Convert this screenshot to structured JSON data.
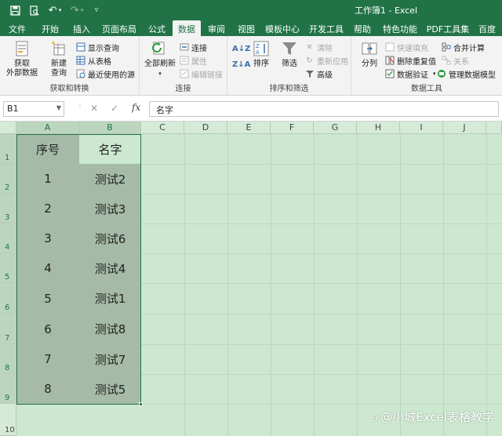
{
  "window": {
    "title": "工作簿1  -  Excel",
    "quick_access": [
      "save-icon",
      "print-preview-icon",
      "undo-icon",
      "redo-icon",
      "customize-icon"
    ]
  },
  "tabs": [
    "文件",
    "开始",
    "插入",
    "页面布局",
    "公式",
    "数据",
    "审阅",
    "视图",
    "模板中心",
    "开发工具",
    "帮助",
    "特色功能",
    "PDF工具集",
    "百度"
  ],
  "active_tab": "数据",
  "ribbon": {
    "group1": {
      "label": "获取和转换",
      "get_data": "获取\n外部数据",
      "new_query": "新建\n查询",
      "show_query": "显示查询",
      "from_table": "从表格",
      "recent_sources": "最近使用的源"
    },
    "group2": {
      "label": "连接",
      "refresh_all": "全部刷新",
      "connections": "连接",
      "properties": "属性",
      "edit_links": "编辑链接"
    },
    "group3": {
      "label": "排序和筛选",
      "sort": "排序",
      "filter": "筛选",
      "clear": "清除",
      "reapply": "重新应用",
      "advanced": "高级"
    },
    "group4": {
      "label": "数据工具",
      "text_to_columns": "分列",
      "flash_fill": "快速填充",
      "remove_duplicates": "删除重复值",
      "data_validation": "数据验证",
      "consolidate": "合并计算",
      "relationships": "关系",
      "manage_model": "管理数据模型"
    }
  },
  "formula_bar": {
    "name_box": "B1",
    "cancel": "✕",
    "enter": "✓",
    "fx": "fx",
    "content": "名字"
  },
  "sheet": {
    "columns": [
      "A",
      "B",
      "C",
      "D",
      "E",
      "F",
      "G",
      "H",
      "I",
      "J"
    ],
    "rows": [
      "1",
      "2",
      "3",
      "4",
      "5",
      "6",
      "7",
      "8",
      "9",
      "10"
    ],
    "header": {
      "A": "序号",
      "B": "名字"
    },
    "data": [
      {
        "A": "1",
        "B": "测试2"
      },
      {
        "A": "2",
        "B": "测试3"
      },
      {
        "A": "3",
        "B": "测试6"
      },
      {
        "A": "4",
        "B": "测试4"
      },
      {
        "A": "5",
        "B": "测试1"
      },
      {
        "A": "6",
        "B": "测试8"
      },
      {
        "A": "7",
        "B": "测试7"
      },
      {
        "A": "8",
        "B": "测试5"
      }
    ]
  },
  "watermark": "@小城Excel表格教学",
  "colors": {
    "accent": "#217346",
    "sheet_bg": "#cce8cf",
    "selected_fill": "#a5bba7"
  }
}
